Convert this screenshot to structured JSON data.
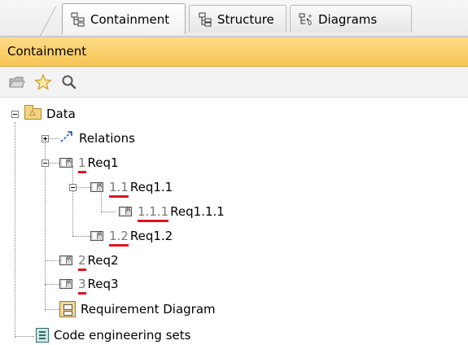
{
  "tabs": [
    {
      "label": "Containment",
      "icon": "containment-tree-icon",
      "active": true
    },
    {
      "label": "Structure",
      "icon": "structure-tree-icon",
      "active": false
    },
    {
      "label": "Diagrams",
      "icon": "diagrams-tree-icon",
      "active": false
    }
  ],
  "panel": {
    "title": "Containment"
  },
  "toolbar": {
    "buttons": [
      {
        "icon": "open-folder-icon"
      },
      {
        "icon": "star-icon"
      },
      {
        "icon": "search-icon"
      }
    ]
  },
  "tree": {
    "data": {
      "label": "Data",
      "icon": "package-icon",
      "expanded": true
    },
    "relations": {
      "label": "Relations",
      "icon": "relation-icon",
      "expanded": false
    },
    "req1": {
      "number": "1",
      "label": "Req1",
      "icon": "requirement-icon",
      "expanded": true
    },
    "req1_1": {
      "number": "1.1",
      "label": "Req1.1",
      "icon": "requirement-icon",
      "expanded": true
    },
    "req1_1_1": {
      "number": "1.1.1",
      "label": "Req1.1.1",
      "icon": "requirement-icon"
    },
    "req1_2": {
      "number": "1.2",
      "label": "Req1.2",
      "icon": "requirement-icon"
    },
    "req2": {
      "number": "2",
      "label": "Req2",
      "icon": "requirement-icon"
    },
    "req3": {
      "number": "3",
      "label": "Req3",
      "icon": "requirement-icon"
    },
    "req_diagram": {
      "label": "Requirement Diagram",
      "icon": "requirement-diagram-icon"
    },
    "code_sets": {
      "label": "Code engineering sets",
      "icon": "code-engineering-sets-icon"
    }
  },
  "colors": {
    "header_bg": "#f9cf6a",
    "number_underline": "#e0141b",
    "number_text": "#7a7a7a"
  }
}
